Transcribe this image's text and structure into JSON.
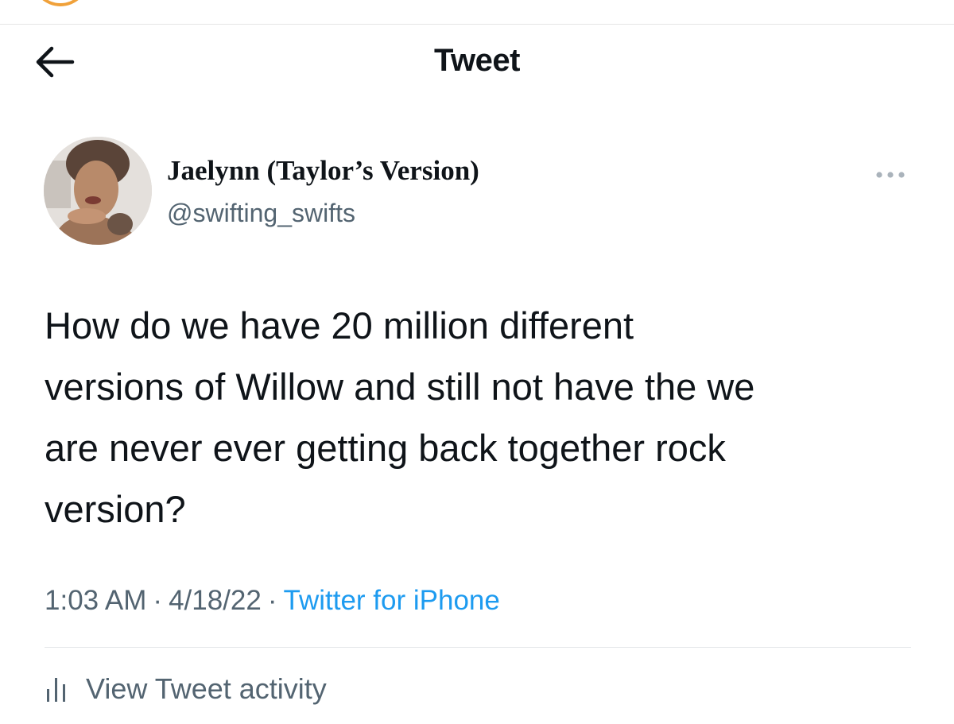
{
  "header": {
    "title": "Tweet",
    "back_icon": "arrow-left-icon"
  },
  "author": {
    "display_name": "Jaelynn (Taylor’s Version)",
    "handle": "@swifting_swifts",
    "more_icon": "more-horizontal-icon"
  },
  "tweet": {
    "text": "How do we have 20 million different\nversions of Willow and still not have  the we\nare never ever getting back together rock\nversion?",
    "time": "1:03 AM",
    "separator": "·",
    "date": "4/18/22",
    "source": "Twitter for iPhone"
  },
  "activity": {
    "label": "View Tweet activity",
    "icon": "bar-chart-icon"
  },
  "colors": {
    "text_primary": "#0f1419",
    "text_secondary": "#536471",
    "link": "#1d9bf0"
  }
}
